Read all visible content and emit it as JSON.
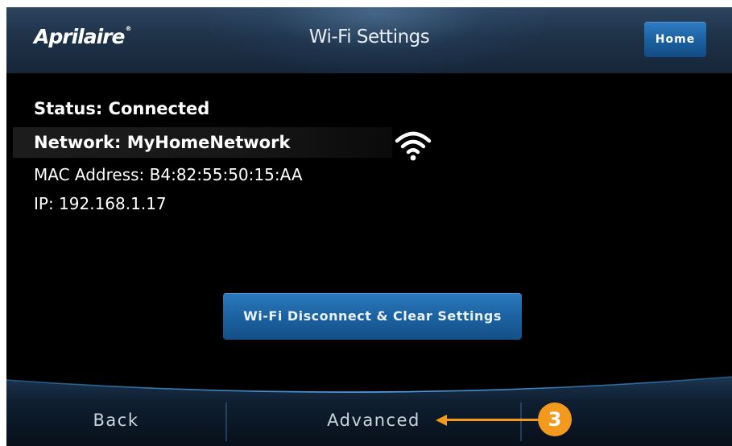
{
  "header": {
    "logo_text": "Aprilaire",
    "logo_mark": "®",
    "title": "Wi-Fi Settings",
    "home_label": "Home"
  },
  "info": {
    "status": "Status: Connected",
    "network": "Network: MyHomeNetwork",
    "mac": "MAC Address: B4:82:55:50:15:AA",
    "ip": "IP: 192.168.1.17",
    "signal_icon": "wifi-signal-icon",
    "signal_bars": 3,
    "signal_bars_max": 3
  },
  "actions": {
    "disconnect_label": "Wi-Fi Disconnect & Clear Settings"
  },
  "footer": {
    "back_label": "Back",
    "advanced_label": "Advanced",
    "empty_label": ""
  },
  "annotation": {
    "number": "3",
    "color": "#f39a1e"
  },
  "colors": {
    "accent_blue": "#1b609f",
    "header_bg": "#1e3248",
    "footer_line": "#3d8fd6"
  }
}
